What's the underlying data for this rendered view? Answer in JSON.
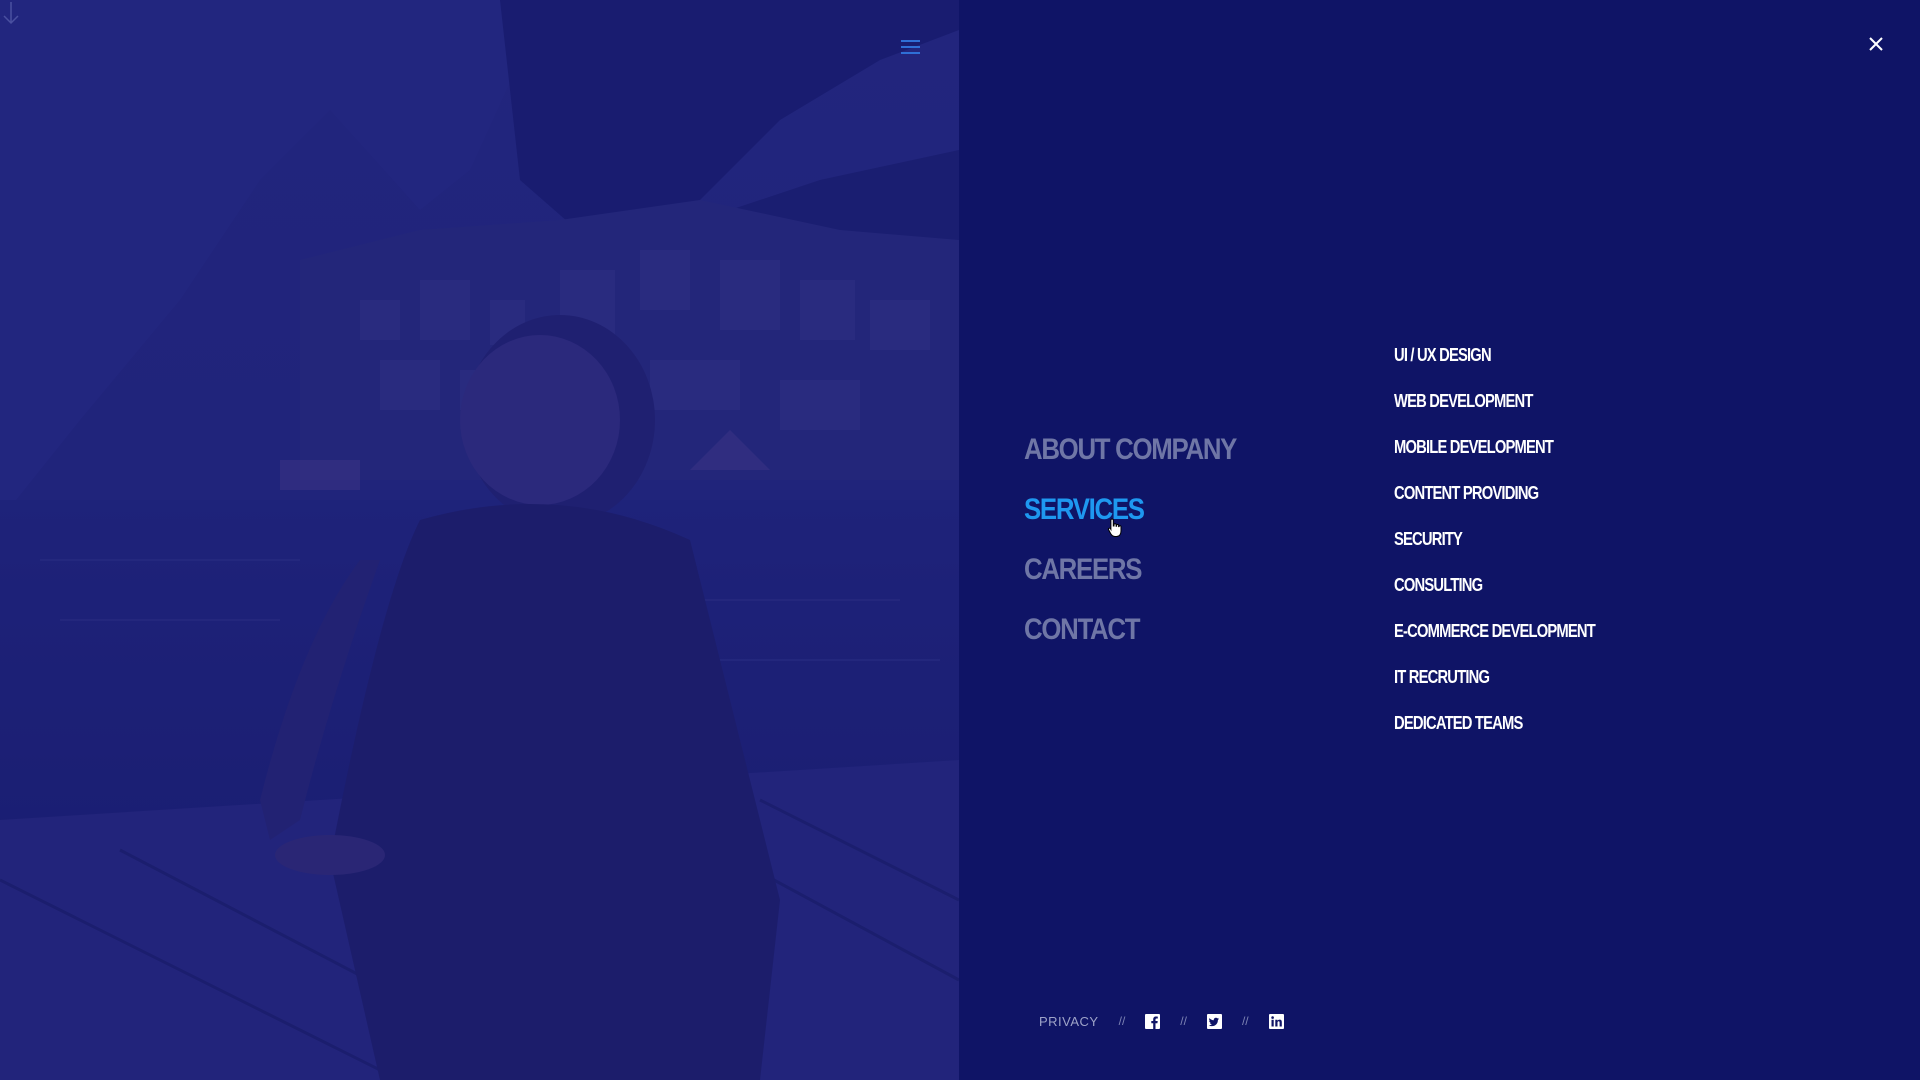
{
  "header": {
    "menu_icon": "hamburger-icon",
    "close_icon": "close-icon"
  },
  "main_nav": {
    "items": [
      {
        "label": "ABOUT COMPANY",
        "active": false
      },
      {
        "label": "SERVICES",
        "active": true
      },
      {
        "label": "CAREERS",
        "active": false
      },
      {
        "label": "CONTACT",
        "active": false
      }
    ]
  },
  "services_submenu": {
    "items": [
      "UI / UX DESIGN",
      "WEB DEVELOPMENT",
      "MOBILE DEVELOPMENT",
      "CONTENT PROVIDING",
      "SECURITY",
      "CONSULTING",
      "E-COMMERCE DEVELOPMENT",
      "IT RECRUTING",
      "DEDICATED TEAMS"
    ]
  },
  "footer": {
    "privacy_label": "PRIVACY",
    "separator": "//",
    "social": [
      "facebook-icon",
      "twitter-icon",
      "linkedin-icon"
    ]
  },
  "scroll_indicator": "arrow-down-icon",
  "colors": {
    "background": "#0f1466",
    "active_nav": "#1e98f0",
    "inactive_nav": "#6f76a6",
    "submenu_text": "#ffffff"
  }
}
